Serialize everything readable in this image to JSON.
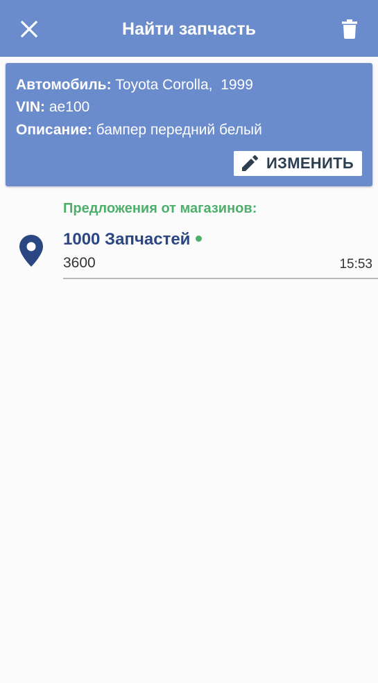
{
  "appbar": {
    "title": "Найти запчасть",
    "close_icon": "close-icon",
    "delete_icon": "trash-icon",
    "background_color": "#6a8bcc"
  },
  "request": {
    "car_label": "Автомобиль:",
    "car_value": "Toyota Corolla,  1999",
    "vin_label": "VIN:",
    "vin_value": "ae100",
    "description_label": "Описание:",
    "description_value": "бампер передний белый",
    "edit_button_label": "ИЗМЕНИТЬ",
    "edit_icon": "pencil-icon"
  },
  "offers": {
    "heading": "Предложения от магазинов:",
    "heading_color": "#4caf6a",
    "items": [
      {
        "shop_name": "1000 Запчастей",
        "price": "3600",
        "time": "15:53",
        "status": "online",
        "status_color": "#4caf6a",
        "icon": "location-pin-icon"
      }
    ]
  }
}
